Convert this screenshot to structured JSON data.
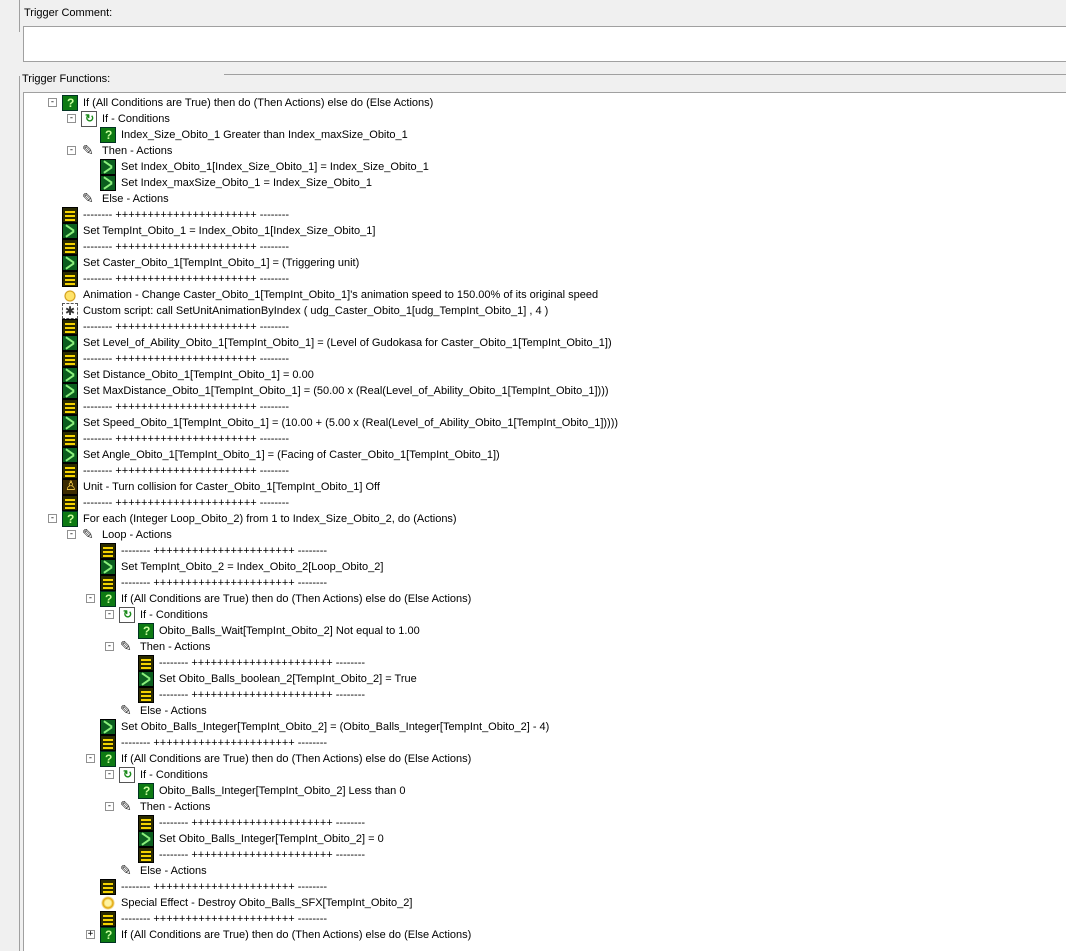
{
  "labels": {
    "trigger_comment": "Trigger Comment:",
    "trigger_functions": "Trigger Functions:"
  },
  "comment": {
    "value": ""
  },
  "rows": [
    {
      "d": 1,
      "exp": "-",
      "icon": "cond",
      "text": "If (All Conditions are True) then do (Then Actions) else do (Else Actions)"
    },
    {
      "d": 2,
      "exp": "-",
      "icon": "ifcond",
      "text": "If - Conditions"
    },
    {
      "d": 3,
      "exp": "",
      "icon": "cond",
      "text": "Index_Size_Obito_1 Greater than Index_maxSize_Obito_1"
    },
    {
      "d": 2,
      "exp": "-",
      "icon": "actions",
      "text": "Then - Actions"
    },
    {
      "d": 3,
      "exp": "",
      "icon": "set",
      "text": "Set Index_Obito_1[Index_Size_Obito_1] = Index_Size_Obito_1"
    },
    {
      "d": 3,
      "exp": "",
      "icon": "set",
      "text": "Set Index_maxSize_Obito_1 = Index_Size_Obito_1"
    },
    {
      "d": 2,
      "exp": "",
      "icon": "actions",
      "text": "Else - Actions"
    },
    {
      "d": 1,
      "exp": "",
      "icon": "comment",
      "text": "-------- ++++++++++++++++++++++ --------"
    },
    {
      "d": 1,
      "exp": "",
      "icon": "set",
      "text": "Set TempInt_Obito_1 = Index_Obito_1[Index_Size_Obito_1]"
    },
    {
      "d": 1,
      "exp": "",
      "icon": "comment",
      "text": "-------- ++++++++++++++++++++++ --------"
    },
    {
      "d": 1,
      "exp": "",
      "icon": "set",
      "text": "Set Caster_Obito_1[TempInt_Obito_1] = (Triggering unit)"
    },
    {
      "d": 1,
      "exp": "",
      "icon": "comment",
      "text": "-------- ++++++++++++++++++++++ --------"
    },
    {
      "d": 1,
      "exp": "",
      "icon": "anim",
      "text": "Animation - Change Caster_Obito_1[TempInt_Obito_1]'s animation speed to 150.00% of its original speed"
    },
    {
      "d": 1,
      "exp": "",
      "icon": "script",
      "text": "Custom script:   call SetUnitAnimationByIndex ( udg_Caster_Obito_1[udg_TempInt_Obito_1] , 4 )"
    },
    {
      "d": 1,
      "exp": "",
      "icon": "comment",
      "text": "-------- ++++++++++++++++++++++ --------"
    },
    {
      "d": 1,
      "exp": "",
      "icon": "set",
      "text": "Set Level_of_Ability_Obito_1[TempInt_Obito_1] = (Level of Gudokasa  for Caster_Obito_1[TempInt_Obito_1])"
    },
    {
      "d": 1,
      "exp": "",
      "icon": "comment",
      "text": "-------- ++++++++++++++++++++++ --------"
    },
    {
      "d": 1,
      "exp": "",
      "icon": "set",
      "text": "Set Distance_Obito_1[TempInt_Obito_1] = 0.00"
    },
    {
      "d": 1,
      "exp": "",
      "icon": "set",
      "text": "Set MaxDistance_Obito_1[TempInt_Obito_1] = (50.00 x (Real(Level_of_Ability_Obito_1[TempInt_Obito_1])))"
    },
    {
      "d": 1,
      "exp": "",
      "icon": "comment",
      "text": "-------- ++++++++++++++++++++++ --------"
    },
    {
      "d": 1,
      "exp": "",
      "icon": "set",
      "text": "Set Speed_Obito_1[TempInt_Obito_1] = (10.00 + (5.00 x (Real(Level_of_Ability_Obito_1[TempInt_Obito_1]))))"
    },
    {
      "d": 1,
      "exp": "",
      "icon": "comment",
      "text": "-------- ++++++++++++++++++++++ --------"
    },
    {
      "d": 1,
      "exp": "",
      "icon": "set",
      "text": "Set Angle_Obito_1[TempInt_Obito_1] = (Facing of Caster_Obito_1[TempInt_Obito_1])"
    },
    {
      "d": 1,
      "exp": "",
      "icon": "comment",
      "text": "-------- ++++++++++++++++++++++ --------"
    },
    {
      "d": 1,
      "exp": "",
      "icon": "unit",
      "text": "Unit - Turn collision for Caster_Obito_1[TempInt_Obito_1] Off"
    },
    {
      "d": 1,
      "exp": "",
      "icon": "comment",
      "text": "-------- ++++++++++++++++++++++ --------"
    },
    {
      "d": 1,
      "exp": "-",
      "icon": "cond",
      "text": "For each (Integer Loop_Obito_2) from 1 to Index_Size_Obito_2, do (Actions)"
    },
    {
      "d": 2,
      "exp": "-",
      "icon": "actions",
      "text": "Loop - Actions"
    },
    {
      "d": 3,
      "exp": "",
      "icon": "comment",
      "text": "-------- ++++++++++++++++++++++ --------"
    },
    {
      "d": 3,
      "exp": "",
      "icon": "set",
      "text": "Set TempInt_Obito_2 = Index_Obito_2[Loop_Obito_2]"
    },
    {
      "d": 3,
      "exp": "",
      "icon": "comment",
      "text": "-------- ++++++++++++++++++++++ --------"
    },
    {
      "d": 3,
      "exp": "-",
      "icon": "cond",
      "text": "If (All Conditions are True) then do (Then Actions) else do (Else Actions)"
    },
    {
      "d": 4,
      "exp": "-",
      "icon": "ifcond",
      "text": "If - Conditions"
    },
    {
      "d": 5,
      "exp": "",
      "icon": "cond",
      "text": "Obito_Balls_Wait[TempInt_Obito_2] Not equal to 1.00"
    },
    {
      "d": 4,
      "exp": "-",
      "icon": "actions",
      "text": "Then - Actions"
    },
    {
      "d": 5,
      "exp": "",
      "icon": "comment",
      "text": "-------- ++++++++++++++++++++++ --------"
    },
    {
      "d": 5,
      "exp": "",
      "icon": "set",
      "text": "Set Obito_Balls_boolean_2[TempInt_Obito_2] = True"
    },
    {
      "d": 5,
      "exp": "",
      "icon": "comment",
      "text": "-------- ++++++++++++++++++++++ --------"
    },
    {
      "d": 4,
      "exp": "",
      "icon": "actions",
      "text": "Else - Actions"
    },
    {
      "d": 3,
      "exp": "",
      "icon": "set",
      "text": "Set Obito_Balls_Integer[TempInt_Obito_2] = (Obito_Balls_Integer[TempInt_Obito_2] - 4)"
    },
    {
      "d": 3,
      "exp": "",
      "icon": "comment",
      "text": "-------- ++++++++++++++++++++++ --------"
    },
    {
      "d": 3,
      "exp": "-",
      "icon": "cond",
      "text": "If (All Conditions are True) then do (Then Actions) else do (Else Actions)"
    },
    {
      "d": 4,
      "exp": "-",
      "icon": "ifcond",
      "text": "If - Conditions"
    },
    {
      "d": 5,
      "exp": "",
      "icon": "cond",
      "text": "Obito_Balls_Integer[TempInt_Obito_2] Less than 0"
    },
    {
      "d": 4,
      "exp": "-",
      "icon": "actions",
      "text": "Then - Actions"
    },
    {
      "d": 5,
      "exp": "",
      "icon": "comment",
      "text": "-------- ++++++++++++++++++++++ --------"
    },
    {
      "d": 5,
      "exp": "",
      "icon": "set",
      "text": "Set Obito_Balls_Integer[TempInt_Obito_2] = 0"
    },
    {
      "d": 5,
      "exp": "",
      "icon": "comment",
      "text": "-------- ++++++++++++++++++++++ --------"
    },
    {
      "d": 4,
      "exp": "",
      "icon": "actions",
      "text": "Else - Actions"
    },
    {
      "d": 3,
      "exp": "",
      "icon": "comment",
      "text": "-------- ++++++++++++++++++++++ --------"
    },
    {
      "d": 3,
      "exp": "",
      "icon": "sfx",
      "text": "Special Effect - Destroy Obito_Balls_SFX[TempInt_Obito_2]"
    },
    {
      "d": 3,
      "exp": "",
      "icon": "comment",
      "text": "-------- ++++++++++++++++++++++ --------"
    },
    {
      "d": 3,
      "exp": "+",
      "icon": "cond",
      "text": "If (All Conditions are True) then do (Then Actions) else do (Else Actions)"
    }
  ]
}
